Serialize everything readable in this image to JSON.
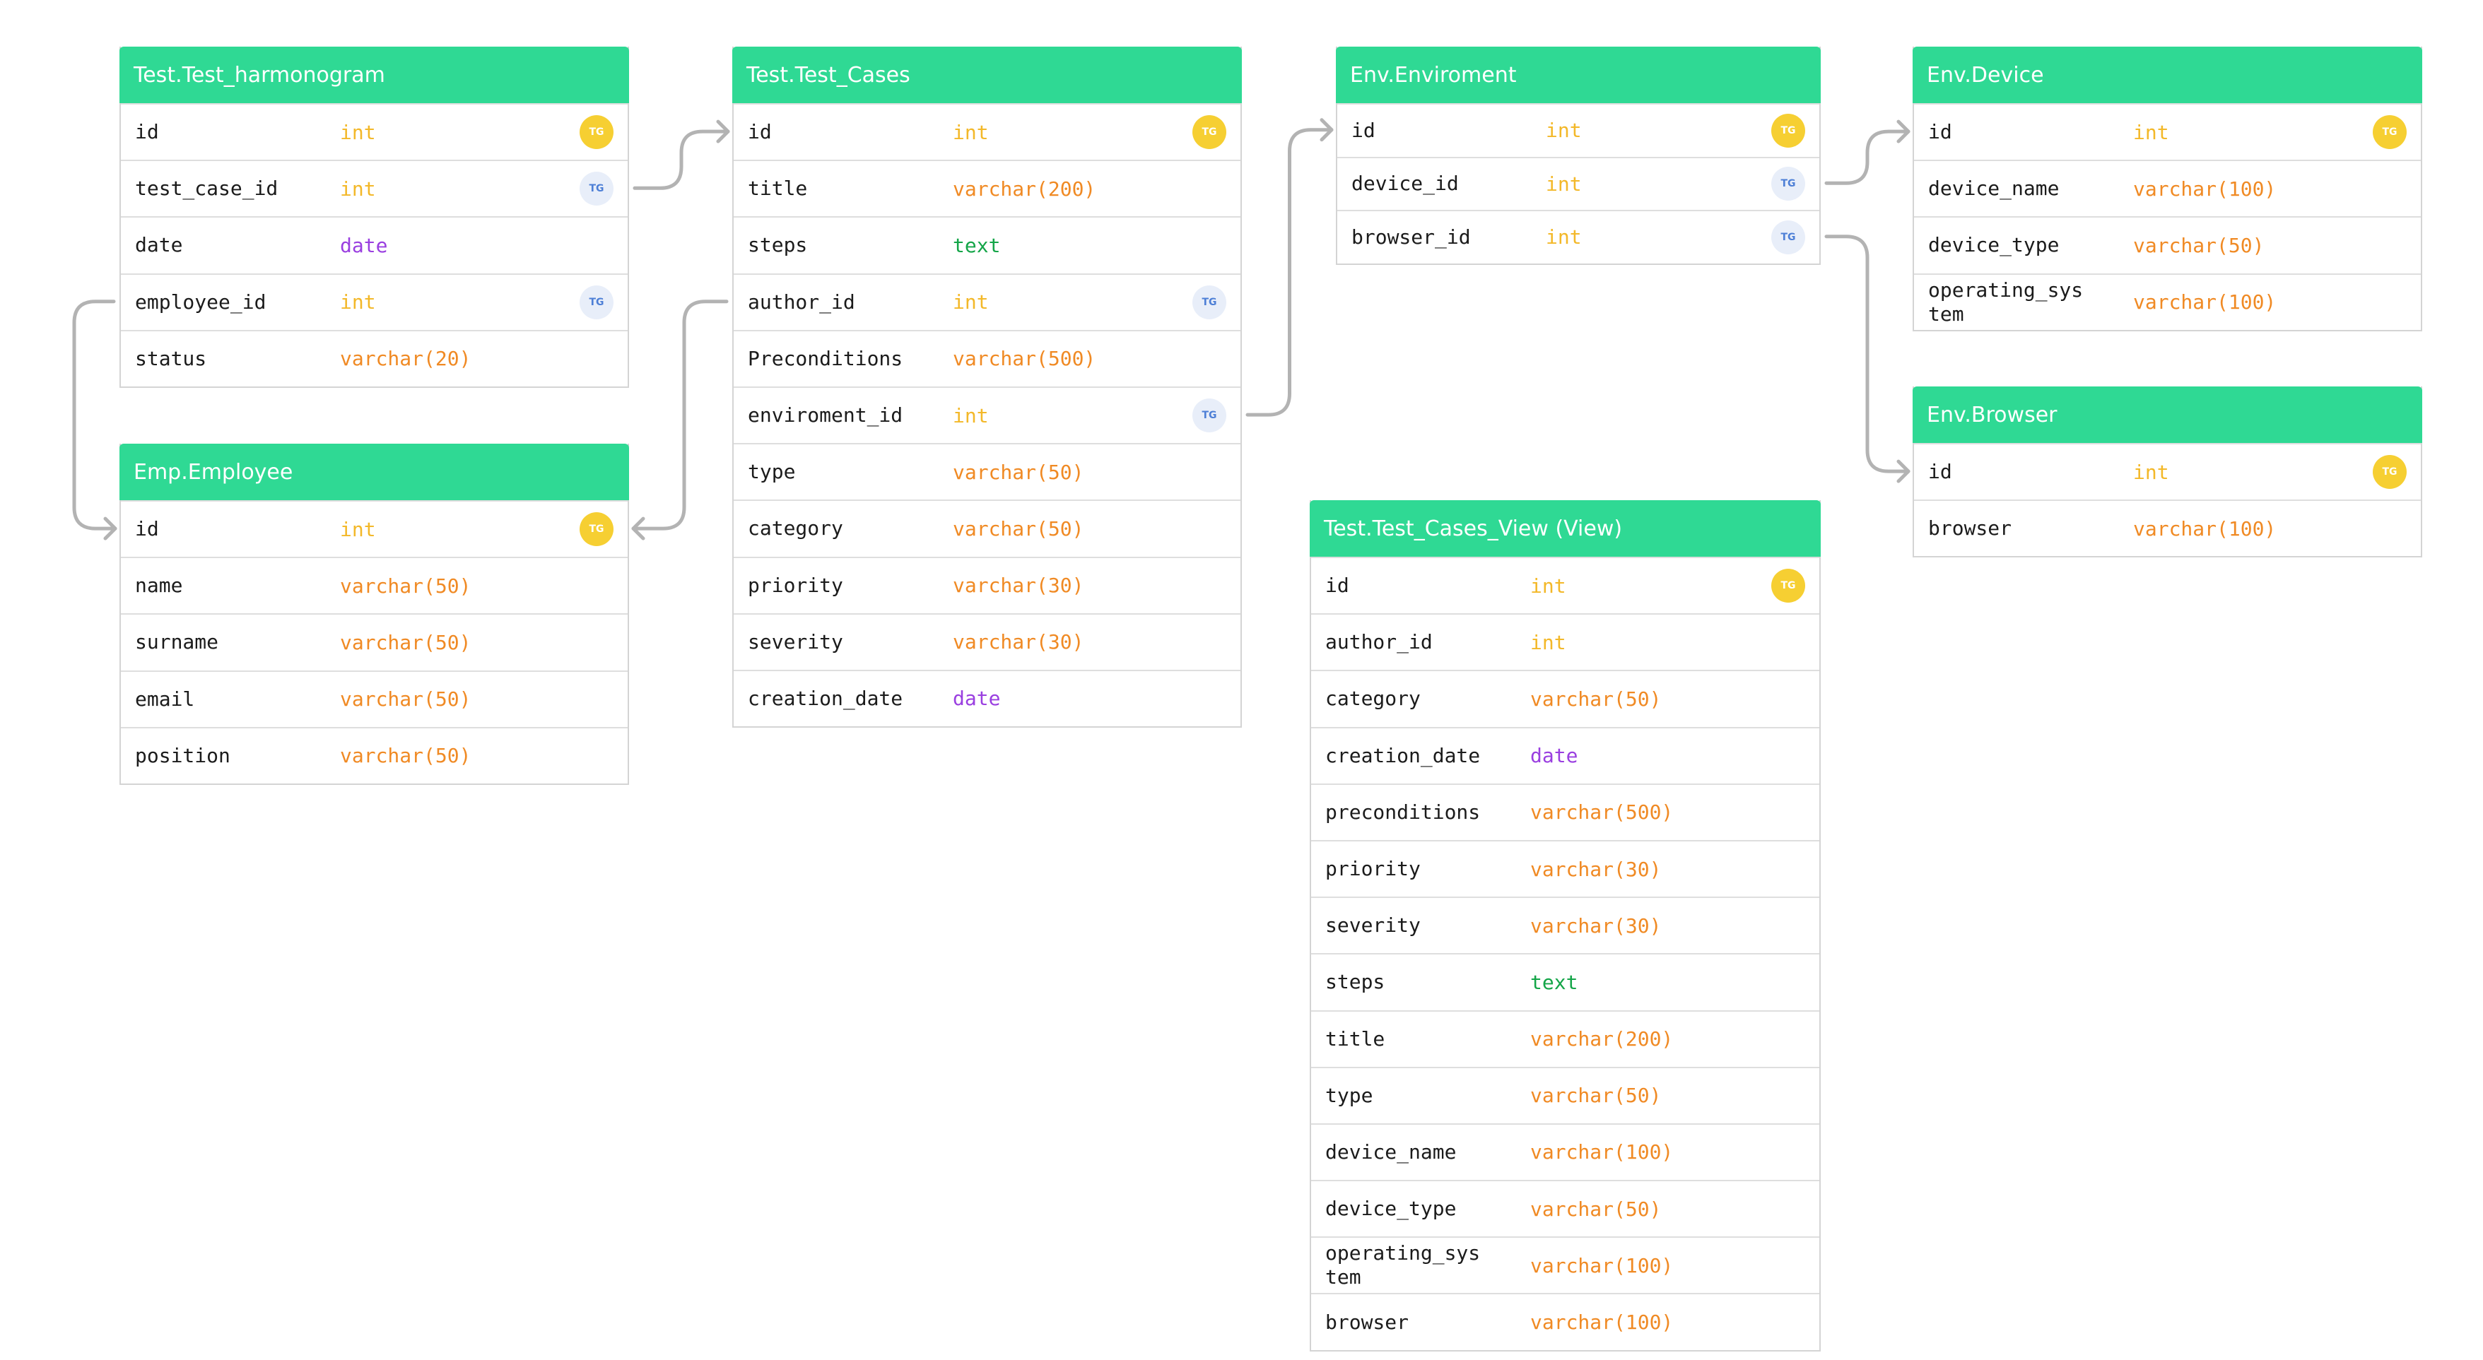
{
  "colors": {
    "header_bg": "#2fd994",
    "int": "#f3b829",
    "varchar": "#f08a24",
    "date": "#9a3fe0",
    "text": "#14a548",
    "pk_badge": "#f6cf32",
    "fk_badge": "#e8eef9",
    "connector": "#b3b3b3"
  },
  "tables": [
    {
      "id": "test-harmonogram",
      "title": "Test.Test_harmonogram",
      "fields": [
        {
          "name": "id",
          "type": "int",
          "kind": "int",
          "key": "pk"
        },
        {
          "name": "test_case_id",
          "type": "int",
          "kind": "int",
          "key": "fk"
        },
        {
          "name": "date",
          "type": "date",
          "kind": "date"
        },
        {
          "name": "employee_id",
          "type": "int",
          "kind": "int",
          "key": "fk"
        },
        {
          "name": "status",
          "type": "varchar(20)",
          "kind": "varchar"
        }
      ]
    },
    {
      "id": "emp-employee",
      "title": "Emp.Employee",
      "fields": [
        {
          "name": "id",
          "type": "int",
          "kind": "int",
          "key": "pk"
        },
        {
          "name": "name",
          "type": "varchar(50)",
          "kind": "varchar"
        },
        {
          "name": "surname",
          "type": "varchar(50)",
          "kind": "varchar"
        },
        {
          "name": "email",
          "type": "varchar(50)",
          "kind": "varchar"
        },
        {
          "name": "position",
          "type": "varchar(50)",
          "kind": "varchar"
        }
      ]
    },
    {
      "id": "test-cases",
      "title": "Test.Test_Cases",
      "fields": [
        {
          "name": "id",
          "type": "int",
          "kind": "int",
          "key": "pk"
        },
        {
          "name": "title",
          "type": "varchar(200)",
          "kind": "varchar"
        },
        {
          "name": "steps",
          "type": "text",
          "kind": "text"
        },
        {
          "name": "author_id",
          "type": "int",
          "kind": "int",
          "key": "fk"
        },
        {
          "name": "Preconditions",
          "type": "varchar(500)",
          "kind": "varchar"
        },
        {
          "name": "enviroment_id",
          "type": "int",
          "kind": "int",
          "key": "fk"
        },
        {
          "name": "type",
          "type": "varchar(50)",
          "kind": "varchar"
        },
        {
          "name": "category",
          "type": "varchar(50)",
          "kind": "varchar"
        },
        {
          "name": "priority",
          "type": "varchar(30)",
          "kind": "varchar"
        },
        {
          "name": "severity",
          "type": "varchar(30)",
          "kind": "varchar"
        },
        {
          "name": "creation_date",
          "type": "date",
          "kind": "date"
        }
      ]
    },
    {
      "id": "env-enviroment",
      "title": "Env.Enviroment",
      "fields": [
        {
          "name": "id",
          "type": "int",
          "kind": "int",
          "key": "pk"
        },
        {
          "name": "device_id",
          "type": "int",
          "kind": "int",
          "key": "fk"
        },
        {
          "name": "browser_id",
          "type": "int",
          "kind": "int",
          "key": "fk"
        }
      ]
    },
    {
      "id": "test-cases-view",
      "title": "Test.Test_Cases_View (View)",
      "fields": [
        {
          "name": "id",
          "type": "int",
          "kind": "int",
          "key": "pk"
        },
        {
          "name": "author_id",
          "type": "int",
          "kind": "int"
        },
        {
          "name": "category",
          "type": "varchar(50)",
          "kind": "varchar"
        },
        {
          "name": "creation_date",
          "type": "date",
          "kind": "date"
        },
        {
          "name": "preconditions",
          "type": "varchar(500)",
          "kind": "varchar"
        },
        {
          "name": "priority",
          "type": "varchar(30)",
          "kind": "varchar"
        },
        {
          "name": "severity",
          "type": "varchar(30)",
          "kind": "varchar"
        },
        {
          "name": "steps",
          "type": "text",
          "kind": "text"
        },
        {
          "name": "title",
          "type": "varchar(200)",
          "kind": "varchar"
        },
        {
          "name": "type",
          "type": "varchar(50)",
          "kind": "varchar"
        },
        {
          "name": "device_name",
          "type": "varchar(100)",
          "kind": "varchar"
        },
        {
          "name": "device_type",
          "type": "varchar(50)",
          "kind": "varchar"
        },
        {
          "name": "operating_sys\ntem",
          "type": "varchar(100)",
          "kind": "varchar"
        },
        {
          "name": "browser",
          "type": "varchar(100)",
          "kind": "varchar"
        }
      ]
    },
    {
      "id": "env-device",
      "title": "Env.Device",
      "fields": [
        {
          "name": "id",
          "type": "int",
          "kind": "int",
          "key": "pk"
        },
        {
          "name": "device_name",
          "type": "varchar(100)",
          "kind": "varchar"
        },
        {
          "name": "device_type",
          "type": "varchar(50)",
          "kind": "varchar"
        },
        {
          "name": "operating_sys\ntem",
          "type": "varchar(100)",
          "kind": "varchar"
        }
      ]
    },
    {
      "id": "env-browser",
      "title": "Env.Browser",
      "fields": [
        {
          "name": "id",
          "type": "int",
          "kind": "int",
          "key": "pk"
        },
        {
          "name": "browser",
          "type": "varchar(100)",
          "kind": "varchar"
        }
      ]
    }
  ],
  "relations": [
    {
      "from_table": "test-harmonogram",
      "from_field": "test_case_id",
      "to_table": "test-cases",
      "to_field": "id"
    },
    {
      "from_table": "test-harmonogram",
      "from_field": "employee_id",
      "to_table": "emp-employee",
      "to_field": "id"
    },
    {
      "from_table": "test-cases",
      "from_field": "author_id",
      "to_table": "emp-employee",
      "to_field": "id"
    },
    {
      "from_table": "test-cases",
      "from_field": "enviroment_id",
      "to_table": "env-enviroment",
      "to_field": "id"
    },
    {
      "from_table": "env-enviroment",
      "from_field": "device_id",
      "to_table": "env-device",
      "to_field": "id"
    },
    {
      "from_table": "env-enviroment",
      "from_field": "browser_id",
      "to_table": "env-browser",
      "to_field": "id"
    }
  ],
  "badge_label": "TG"
}
